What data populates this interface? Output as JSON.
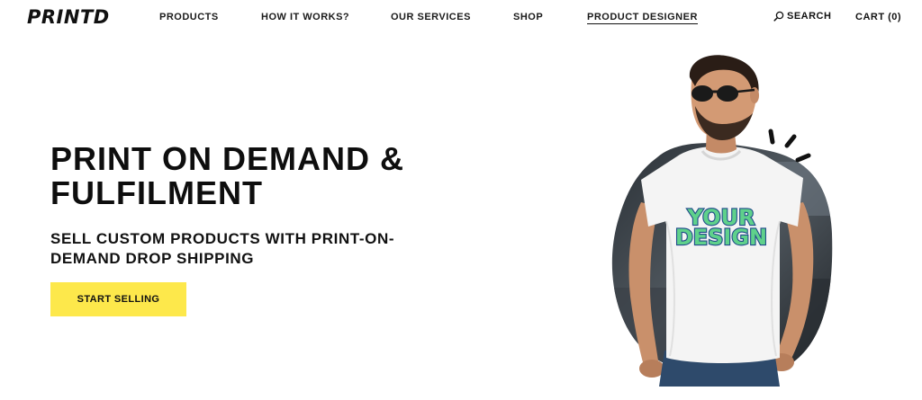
{
  "brand": {
    "logo_text": "PRINTD"
  },
  "nav": {
    "items": [
      {
        "label": "PRODUCTS"
      },
      {
        "label": "HOW IT WORKS?"
      },
      {
        "label": "OUR SERVICES"
      },
      {
        "label": "SHOP"
      },
      {
        "label": "PRODUCT DESIGNER"
      }
    ],
    "search_label": "SEARCH",
    "cart_label": "CART (0)"
  },
  "hero": {
    "title": "PRINT ON DEMAND & FULFILMENT",
    "subtitle": "SELL CUSTOM PRODUCTS WITH PRINT-ON-DEMAND DROP SHIPPING",
    "cta_label": "START SELLING",
    "image": {
      "shirt_print": [
        "YOUR",
        "DESIGN"
      ]
    }
  },
  "colors": {
    "accent_yellow": "#fde84b",
    "text": "#111111",
    "shirt_print_fill": "#5fd18b",
    "shirt_print_outline": "#1f4a8a"
  }
}
